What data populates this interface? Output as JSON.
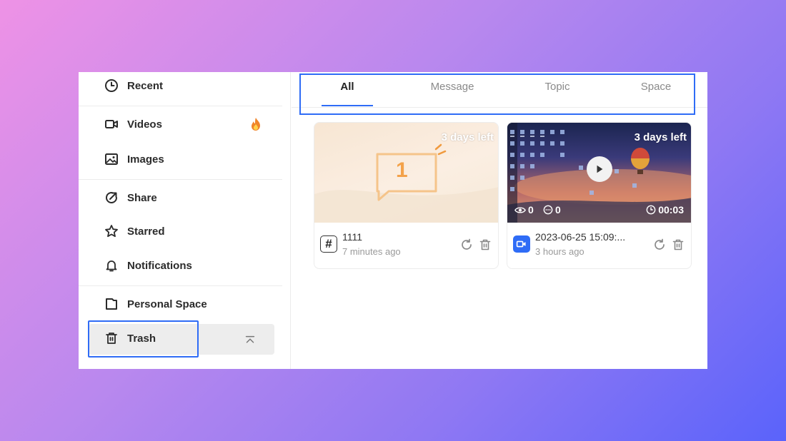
{
  "sidebar": {
    "items": [
      {
        "label": "Recent",
        "icon": "clock-icon"
      },
      {
        "label": "Videos",
        "icon": "video-camera-icon",
        "badge_icon": "fire-icon"
      },
      {
        "label": "Images",
        "icon": "image-icon"
      },
      {
        "label": "Share",
        "icon": "share-icon"
      },
      {
        "label": "Starred",
        "icon": "star-icon"
      },
      {
        "label": "Notifications",
        "icon": "bell-icon"
      },
      {
        "label": "Personal Space",
        "icon": "folder-icon"
      },
      {
        "label": "Trash",
        "icon": "trash-icon",
        "selected": true
      }
    ],
    "collapse_icon": "chevron-up-icon"
  },
  "tabs": [
    {
      "label": "All",
      "active": true
    },
    {
      "label": "Message"
    },
    {
      "label": "Topic"
    },
    {
      "label": "Space"
    }
  ],
  "cards": [
    {
      "days_left": "3 days left",
      "thumb_number": "1",
      "type_icon": "hash-icon",
      "title": "1111",
      "time": "7 minutes ago"
    },
    {
      "days_left": "3 days left",
      "type_icon": "video-icon",
      "title": "2023-06-25 15:09:...",
      "time": "3 hours ago",
      "views": "0",
      "comments": "0",
      "duration": "00:03"
    }
  ],
  "colors": {
    "accent": "#2f6cf6",
    "highlight_box": "#2f6cf6",
    "bg_gradient_start": "#ee92e6",
    "bg_gradient_end": "#5a63fb"
  }
}
